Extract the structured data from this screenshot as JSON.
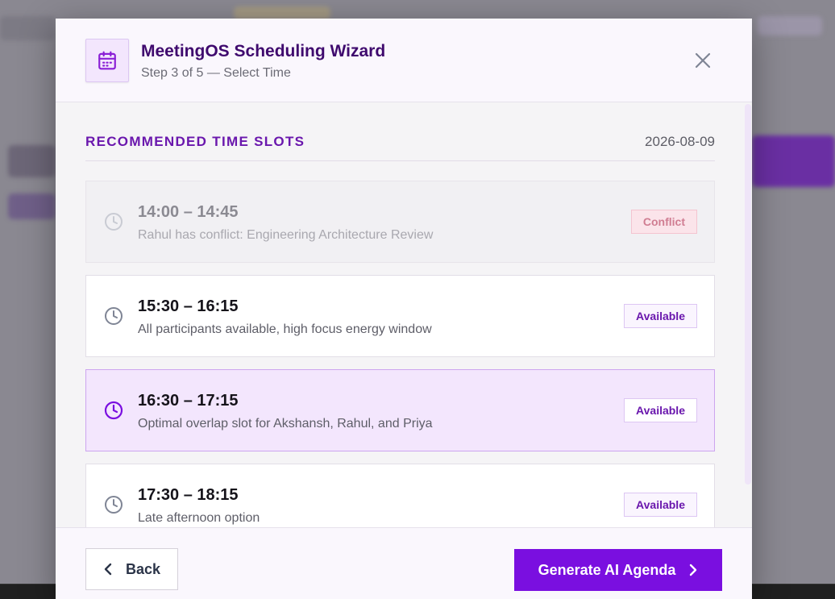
{
  "header": {
    "title": "MeetingOS Scheduling Wizard",
    "subtitle": "Step 3 of 5 — Select Time",
    "icon": "calendar-icon"
  },
  "section": {
    "heading": "RECOMMENDED TIME SLOTS",
    "date": "2026-08-09"
  },
  "slots": [
    {
      "time": "14:00 – 14:45",
      "description": "Rahul has conflict: Engineering Architecture Review",
      "badge": "Conflict",
      "status": "conflict"
    },
    {
      "time": "15:30 – 16:15",
      "description": "All participants available, high focus energy window",
      "badge": "Available",
      "status": "available"
    },
    {
      "time": "16:30 – 17:15",
      "description": "Optimal overlap slot for Akshansh, Rahul, and Priya",
      "badge": "Available",
      "status": "selected"
    },
    {
      "time": "17:30 – 18:15",
      "description": "Late afternoon option",
      "badge": "Available",
      "status": "available"
    }
  ],
  "footer": {
    "back_label": "Back",
    "primary_label": "Generate AI Agenda"
  },
  "colors": {
    "accent": "#7a0fe0",
    "title": "#3f0a6e",
    "selected_bg": "#f3e6fd",
    "conflict_badge": "#d07d92"
  }
}
